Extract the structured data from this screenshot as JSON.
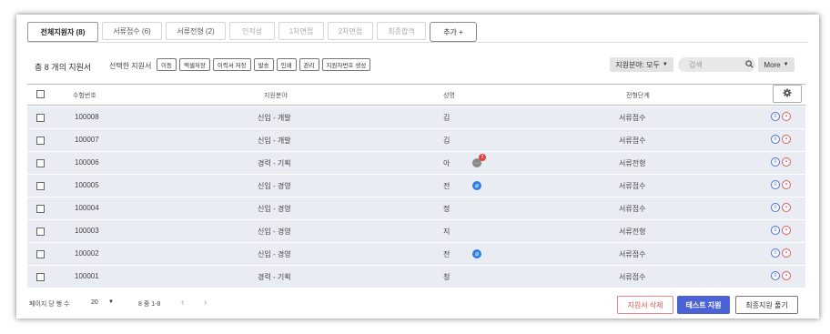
{
  "tabs": [
    {
      "label": "전체지원자 (8)"
    },
    {
      "label": "서류접수 (6)"
    },
    {
      "label": "서류전형 (2)"
    },
    {
      "label": "인적성"
    },
    {
      "label": "1차면접"
    },
    {
      "label": "2차면접"
    },
    {
      "label": "최종합격"
    },
    {
      "label": "추가 +"
    }
  ],
  "toolbar": {
    "count_label": "총 8 개의 지원서",
    "selected_label": "선택한 지원서",
    "actions": [
      "이동",
      "엑셀저장",
      "이력서 저장",
      "발송",
      "인쇄",
      "관리",
      "지원자번호 생성"
    ],
    "filter_label": "지원분야: 모두",
    "search_placeholder": "검색",
    "more_label": "More"
  },
  "table": {
    "headers": {
      "id": "수험번호",
      "field": "지원분야",
      "name": "성명",
      "stage": "전형단계"
    },
    "rows": [
      {
        "id": "100008",
        "field": "신입 - 개발",
        "name": "김",
        "stage": "서류접수"
      },
      {
        "id": "100007",
        "field": "신입 - 개발",
        "name": "김",
        "stage": "서류접수"
      },
      {
        "id": "100006",
        "field": "경력 - 기획",
        "name": "아",
        "stage": "서류전형",
        "messages": "2"
      },
      {
        "id": "100005",
        "field": "신입 - 경영",
        "name": "전",
        "stage": "서류접수"
      },
      {
        "id": "100004",
        "field": "신입 - 경영",
        "name": "정",
        "stage": "서류접수"
      },
      {
        "id": "100003",
        "field": "신입 - 경영",
        "name": "지",
        "stage": "서류전형"
      },
      {
        "id": "100002",
        "field": "신입 - 경영",
        "name": "전",
        "stage": "서류접수"
      },
      {
        "id": "100001",
        "field": "경력 - 기획",
        "name": "청",
        "stage": "서류접수"
      }
    ]
  },
  "footer": {
    "per_page_label": "페이지 당 행 수",
    "per_page_value": "20",
    "range_label": "8 중 1-8",
    "delete_label": "지원서 삭제",
    "test_label": "테스트 지원",
    "final_label": "최종지원 풀기"
  },
  "colors": {
    "row_bg": "#e9ecf2",
    "primary": "#4a62d4",
    "danger": "#e05050",
    "attachment": "#2f7de1"
  }
}
